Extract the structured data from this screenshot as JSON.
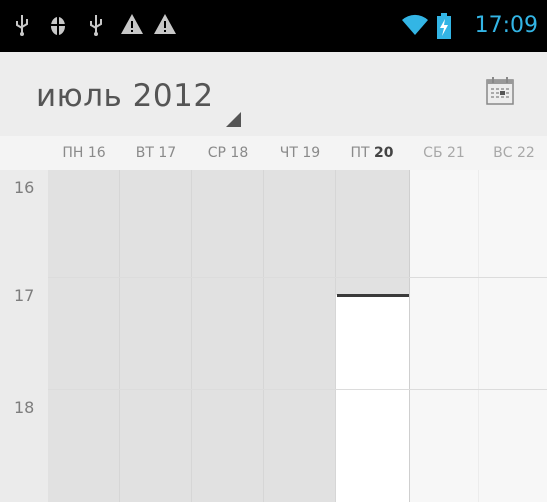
{
  "status_bar": {
    "icons": [
      "usb-icon",
      "android-debug-icon",
      "usb-icon",
      "warning-icon",
      "warning-icon"
    ],
    "right_icons": [
      "wifi-icon",
      "battery-charging-icon"
    ],
    "time": "17:09",
    "accent": "#33b5e5"
  },
  "header": {
    "title": "июль 2012",
    "calendar_icon": "calendar-today-icon"
  },
  "week": {
    "days": [
      {
        "label": "ПН 16",
        "past": true
      },
      {
        "label": "ВТ 17",
        "past": true
      },
      {
        "label": "СР 18",
        "past": true
      },
      {
        "label": "ЧТ 19",
        "past": true
      },
      {
        "label_prefix": "ПТ",
        "label_num": "20",
        "today": true
      },
      {
        "label": "СБ 21",
        "past": false
      },
      {
        "label": "ВС 22",
        "past": false
      }
    ]
  },
  "hours": [
    "16",
    "17",
    "18"
  ],
  "colors": {
    "past_bg": "#e1e1e1",
    "future_bg": "#f7f7f7",
    "today_future_bg": "#ffffff",
    "now_line": "#3a3a3a"
  }
}
